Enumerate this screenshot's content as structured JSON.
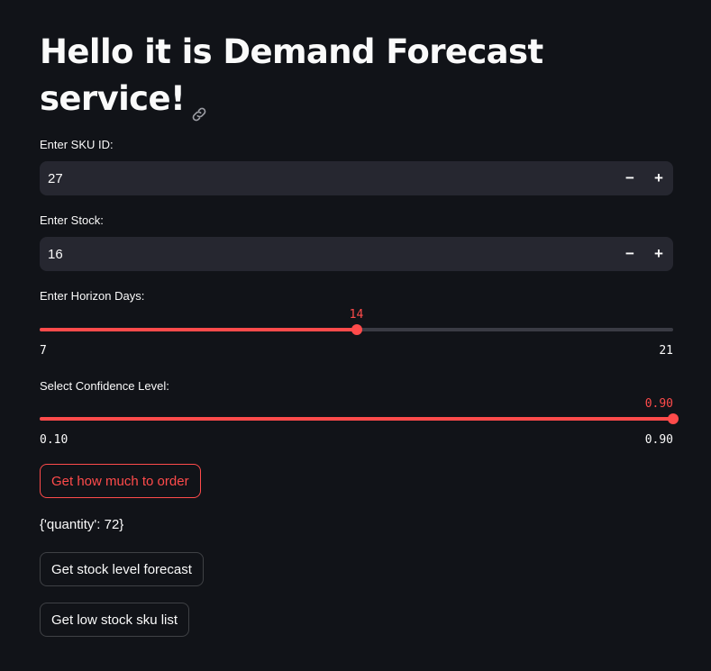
{
  "title": "Hello it is Demand Forecast service!",
  "icons": {
    "anchor": "link-icon",
    "decrement": "minus-icon",
    "increment": "plus-icon"
  },
  "sku": {
    "label": "Enter SKU ID:",
    "value": "27",
    "decrement_label": "−",
    "increment_label": "+"
  },
  "stock": {
    "label": "Enter Stock:",
    "value": "16",
    "decrement_label": "−",
    "increment_label": "+"
  },
  "horizon": {
    "label": "Enter Horizon Days:",
    "value": "14",
    "min": "7",
    "max": "21",
    "fraction": 0.5
  },
  "confidence": {
    "label": "Select Confidence Level:",
    "value": "0.90",
    "min": "0.10",
    "max": "0.90",
    "fraction": 1.0
  },
  "buttons": {
    "order": "Get how much to order",
    "forecast": "Get stock level forecast",
    "low_stock": "Get low stock sku list"
  },
  "result": "{'quantity': 72}",
  "colors": {
    "accent": "#ff4b4b",
    "background": "#111318",
    "input_bg": "#262730"
  }
}
